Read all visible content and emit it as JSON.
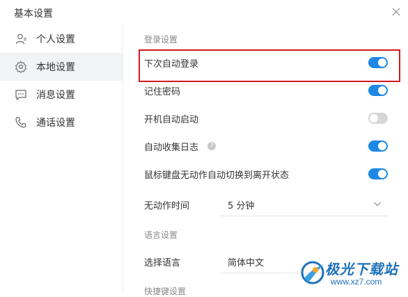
{
  "window": {
    "title": "基本设置"
  },
  "sidebar": {
    "items": [
      {
        "label": "个人设置",
        "icon": "user-icon"
      },
      {
        "label": "本地设置",
        "icon": "gear-icon"
      },
      {
        "label": "消息设置",
        "icon": "chat-icon"
      },
      {
        "label": "通话设置",
        "icon": "phone-icon"
      }
    ],
    "active_index": 1
  },
  "login_section": {
    "title": "登录设置",
    "rows": [
      {
        "label": "下次自动登录",
        "on": true
      },
      {
        "label": "记住密码",
        "on": true
      },
      {
        "label": "开机自动启动",
        "on": false
      },
      {
        "label": "自动收集日志",
        "on": true,
        "help": "?"
      },
      {
        "label": "鼠标键盘无动作自动切换到离开状态",
        "on": true
      }
    ],
    "idle_time": {
      "label": "无动作时间",
      "value": "5 分钟"
    }
  },
  "language_section": {
    "title": "语言设置",
    "select_label": "选择语言",
    "value": "简体中文"
  },
  "shortcut_section": {
    "title": "快捷键设置"
  },
  "watermark": {
    "text": "极光下载站",
    "url": "www.xz7.com"
  },
  "colors": {
    "accent": "#1e88e5",
    "highlight": "#d0191f",
    "toggle_off": "#d6d6d6"
  }
}
